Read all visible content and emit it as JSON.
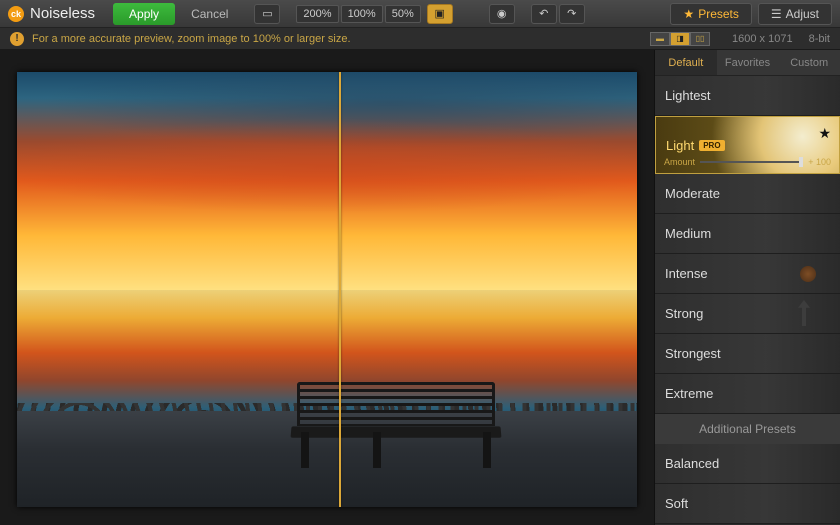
{
  "app": {
    "title": "Noiseless"
  },
  "toolbar": {
    "apply": "Apply",
    "cancel": "Cancel",
    "zoom": [
      "200%",
      "100%",
      "50%"
    ],
    "presets_btn": "Presets",
    "adjust_btn": "Adjust"
  },
  "infobar": {
    "hint": "For a more accurate preview, zoom image to 100% or larger size.",
    "dimensions": "1600 x 1071",
    "depth": "8-bit"
  },
  "sidebar": {
    "tabs": [
      "Default",
      "Favorites",
      "Custom"
    ],
    "active_tab": 0,
    "presets": [
      {
        "label": "Lightest"
      },
      {
        "label": "Light",
        "pro": "PRO",
        "selected": true,
        "amount_label": "Amount",
        "amount_value": "+ 100"
      },
      {
        "label": "Moderate"
      },
      {
        "label": "Medium"
      },
      {
        "label": "Intense"
      },
      {
        "label": "Strong"
      },
      {
        "label": "Strongest"
      },
      {
        "label": "Extreme"
      }
    ],
    "section": "Additional Presets",
    "extra": [
      {
        "label": "Balanced"
      },
      {
        "label": "Soft"
      }
    ]
  }
}
